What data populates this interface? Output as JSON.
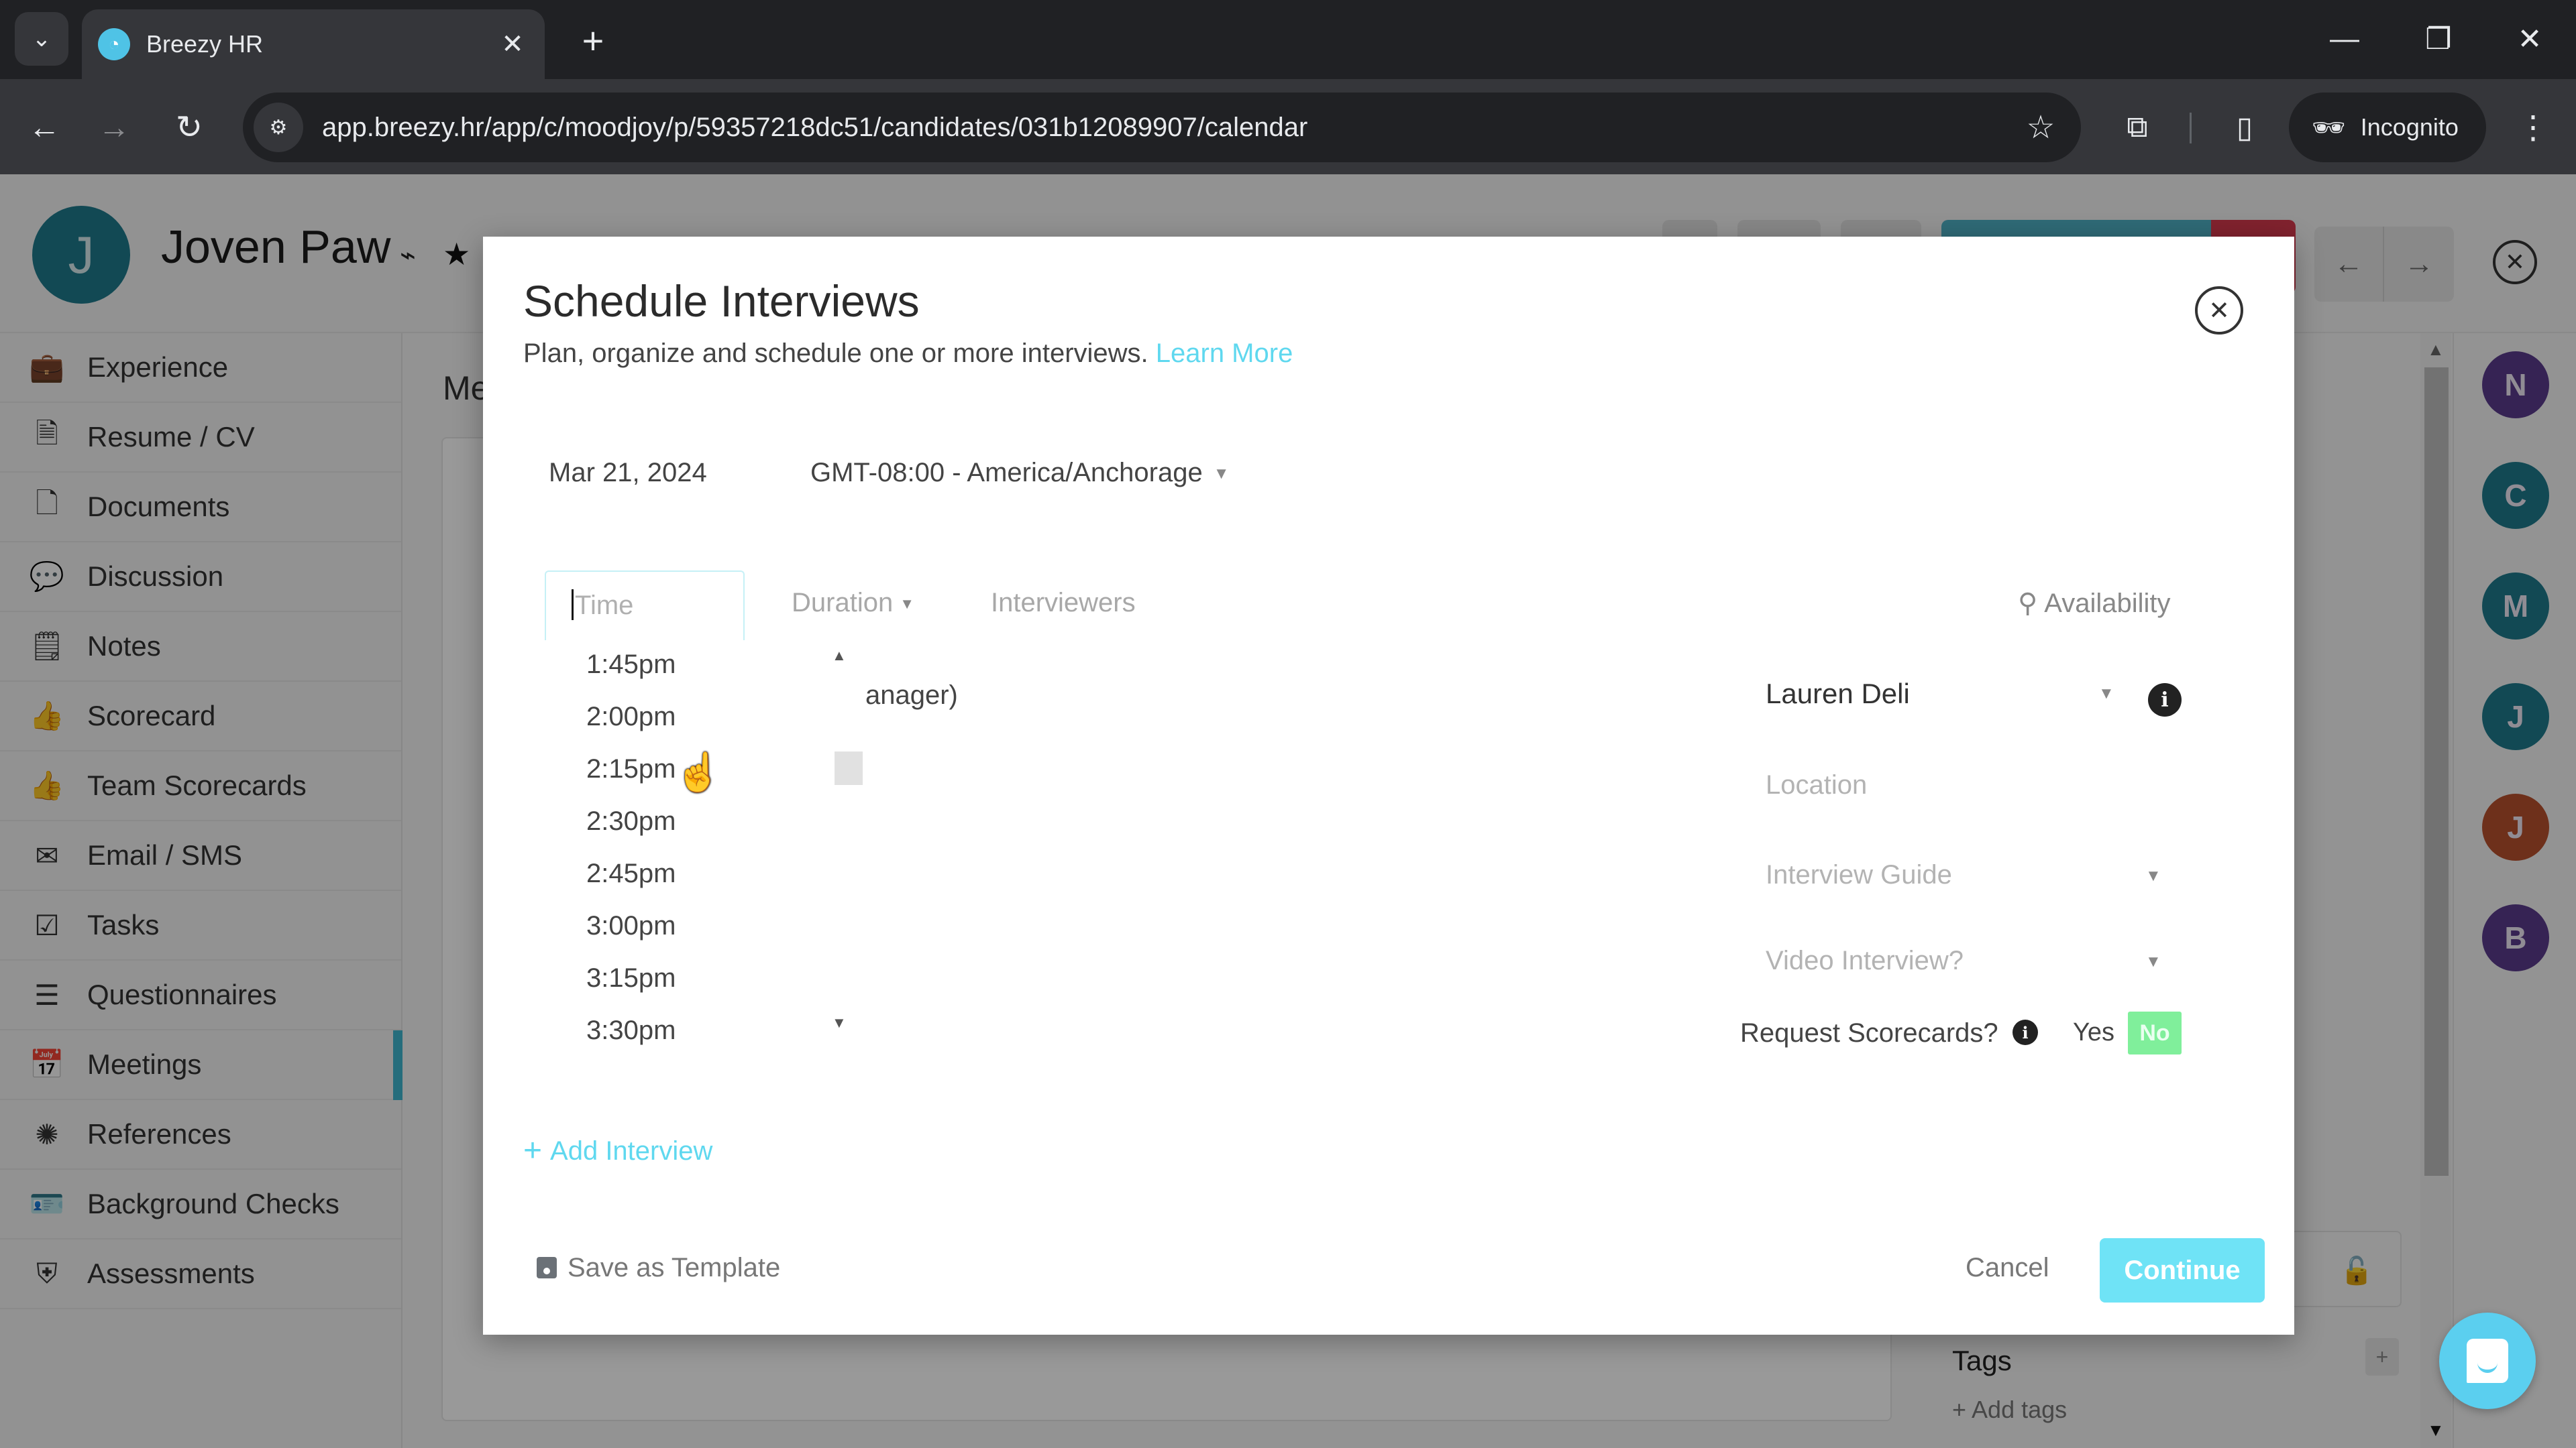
{
  "browser": {
    "tab_title": "Breezy HR",
    "url": "app.breezy.hr/app/c/moodjoy/p/59357218dc51/candidates/031b12089907/calendar",
    "profile_label": "Incognito",
    "icons": {
      "tab_search": "chevron-down-icon",
      "tab_close": "close-icon",
      "new_tab": "plus-icon",
      "minimize": "minimize-icon",
      "restore": "restore-icon",
      "close_window": "close-icon",
      "back": "arrow-left-icon",
      "forward": "arrow-right-icon",
      "reload": "reload-icon",
      "site_info": "tune-icon",
      "bookmark": "star-outline-icon",
      "extensions": "puzzle-icon",
      "side_panel": "side-panel-icon",
      "incognito": "incognito-icon",
      "menu": "kebab-icon"
    },
    "glyphs": {
      "tab_search": "⌄",
      "tab_close": "✕",
      "new_tab": "+",
      "minimize": "—",
      "restore": "❐",
      "close_window": "✕",
      "back": "←",
      "forward": "→",
      "reload": "↻",
      "site_info": "⚙",
      "bookmark": "☆",
      "extensions": "⧉",
      "side_panel": "▯",
      "incognito": "🕶",
      "menu": "⋮",
      "favicon": "◔"
    }
  },
  "candidate": {
    "initial": "J",
    "name": "Joven Paw",
    "avatar_color": "#1f7a8c",
    "rss_glyph": "⌁",
    "star_glyph": "★",
    "nav_prev_glyph": "←",
    "nav_next_glyph": "→",
    "close_glyph": "✕",
    "stage_color": "#4fb1c5",
    "stage_alert_color": "#d83a4e"
  },
  "sidebar": {
    "items": [
      {
        "label": "Experience",
        "icon": "briefcase-icon",
        "glyph": "💼",
        "active": false
      },
      {
        "label": "Resume / CV",
        "icon": "file-text-icon",
        "glyph": "🗎",
        "active": false
      },
      {
        "label": "Documents",
        "icon": "file-icon",
        "glyph": "🗋",
        "active": false
      },
      {
        "label": "Discussion",
        "icon": "comments-icon",
        "glyph": "💬",
        "active": false
      },
      {
        "label": "Notes",
        "icon": "sticky-note-icon",
        "glyph": "🗒",
        "active": false
      },
      {
        "label": "Scorecard",
        "icon": "thumbs-up-icon",
        "glyph": "👍",
        "active": false
      },
      {
        "label": "Team Scorecards",
        "icon": "thumbs-up-icon",
        "glyph": "👍",
        "active": false
      },
      {
        "label": "Email / SMS",
        "icon": "envelope-icon",
        "glyph": "✉",
        "active": false
      },
      {
        "label": "Tasks",
        "icon": "checkbox-icon",
        "glyph": "☑",
        "active": false
      },
      {
        "label": "Questionnaires",
        "icon": "list-icon",
        "glyph": "☰",
        "active": false
      },
      {
        "label": "Meetings",
        "icon": "calendar-icon",
        "glyph": "📅",
        "active": true
      },
      {
        "label": "References",
        "icon": "badge-icon",
        "glyph": "✺",
        "active": false
      },
      {
        "label": "Background Checks",
        "icon": "id-card-icon",
        "glyph": "🪪",
        "active": false
      },
      {
        "label": "Assessments",
        "icon": "shield-check-icon",
        "glyph": "⛨",
        "active": false
      }
    ]
  },
  "content": {
    "title_partial": "Me",
    "lock_glyph": "🔓",
    "tags_title": "Tags",
    "tags_add_glyph": "+",
    "add_tags": "+ Add tags"
  },
  "rail": {
    "avatars": [
      {
        "initial": "N",
        "color": "#5a3b8c"
      },
      {
        "initial": "C",
        "color": "#1f7a8c"
      },
      {
        "initial": "M",
        "color": "#1f7a8c"
      },
      {
        "initial": "J",
        "color": "#1f7a8c"
      },
      {
        "initial": "J",
        "color": "#b8502e"
      },
      {
        "initial": "B",
        "color": "#5a3b8c"
      }
    ]
  },
  "modal": {
    "title": "Schedule Interviews",
    "subtitle": "Plan, organize and schedule one or more interviews.",
    "learn_more": "Learn More",
    "close_glyph": "✕",
    "date": "Mar 21, 2024",
    "timezone": "GMT-08:00 - America/Anchorage",
    "dropdown_glyph": "▼",
    "columns": {
      "time_placeholder": "Time",
      "duration": "Duration",
      "interviewers": "Interviewers",
      "availability": "Availability",
      "search_glyph": "🔍"
    },
    "time_options": [
      "1:45pm",
      "2:00pm",
      "2:15pm",
      "2:30pm",
      "2:45pm",
      "3:00pm",
      "3:15pm",
      "3:30pm"
    ],
    "hovered_time": "2:15pm",
    "scroll_up_glyph": "▲",
    "scroll_down_glyph": "▼",
    "interview_name_partial": "anager)",
    "interviewer": "Lauren Deli",
    "info_glyph": "i",
    "location_placeholder": "Location",
    "interview_guide_placeholder": "Interview Guide",
    "video_interview_placeholder": "Video Interview?",
    "request_scorecards_label": "Request Scorecards?",
    "scorecards_yes": "Yes",
    "scorecards_no": "No",
    "scorecards_selected": "No",
    "add_interview": "Add Interview",
    "add_glyph": "+",
    "save_template": "Save as Template",
    "cancel": "Cancel",
    "continue": "Continue",
    "accent_color": "#5fd8ef",
    "toggle_color": "#80ef9b",
    "cursor_glyph": "☝"
  }
}
